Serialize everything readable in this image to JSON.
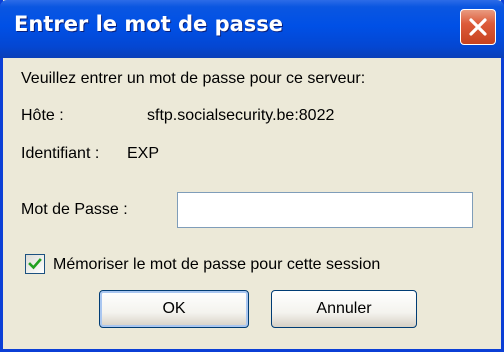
{
  "window": {
    "title": "Entrer le mot de passe"
  },
  "prompt": "Veuillez entrer un mot de passe pour ce serveur:",
  "host": {
    "label": "Hôte :",
    "value": "sftp.socialsecurity.be:8022"
  },
  "user": {
    "label": "Identifiant :",
    "value": "EXP"
  },
  "password": {
    "label": "Mot de Passe :",
    "value": ""
  },
  "remember": {
    "label": "Mémoriser le mot de passe pour cette session",
    "checked": true
  },
  "buttons": {
    "ok": "OK",
    "cancel": "Annuler"
  },
  "icons": {
    "close": "close-icon",
    "check": "checkmark-icon"
  },
  "colors": {
    "titlebar": "#0050e6",
    "close": "#dd5b3a",
    "dialog_bg": "#ece9d8",
    "check": "#21a121"
  }
}
